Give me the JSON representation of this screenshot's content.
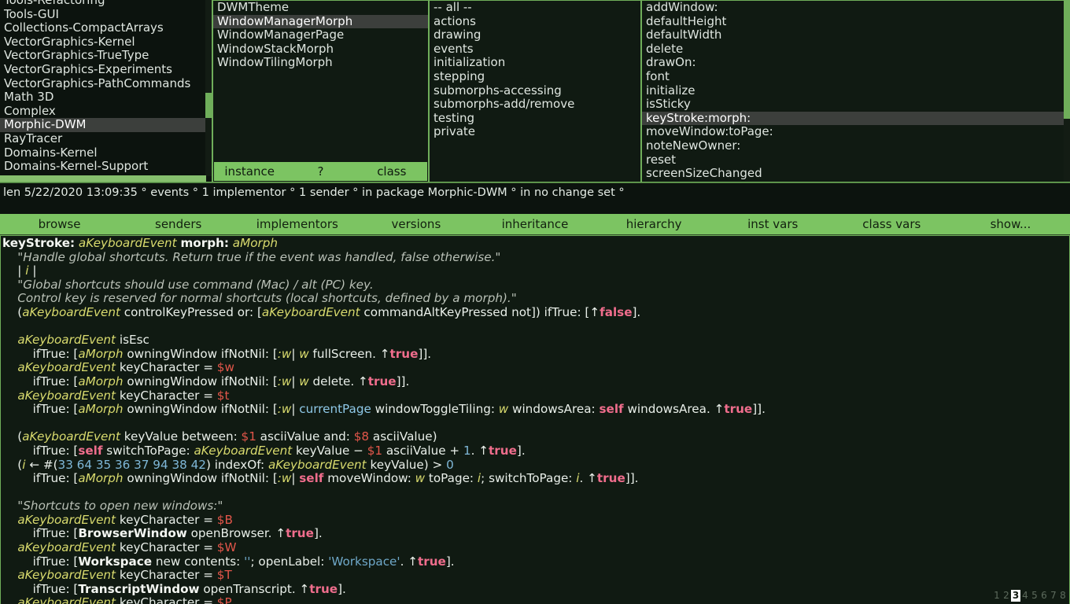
{
  "packages_pane": {
    "name": "package-list",
    "items": [
      {
        "label": "Tools-Refactoring",
        "selected": false
      },
      {
        "label": "Tools-GUI",
        "selected": false
      },
      {
        "label": "Collections-CompactArrays",
        "selected": false
      },
      {
        "label": "VectorGraphics-Kernel",
        "selected": false
      },
      {
        "label": "VectorGraphics-TrueType",
        "selected": false
      },
      {
        "label": "VectorGraphics-Experiments",
        "selected": false
      },
      {
        "label": "VectorGraphics-PathCommands",
        "selected": false
      },
      {
        "label": "Math 3D",
        "selected": false
      },
      {
        "label": "Complex",
        "selected": false
      },
      {
        "label": "Morphic-DWM",
        "selected": true
      },
      {
        "label": "RayTracer",
        "selected": false
      },
      {
        "label": "Domains-Kernel",
        "selected": false
      },
      {
        "label": "Domains-Kernel-Support",
        "selected": false
      }
    ]
  },
  "classes_pane": {
    "name": "class-list",
    "items": [
      {
        "label": "DWMTheme",
        "selected": false
      },
      {
        "label": "WindowManagerMorph",
        "selected": true
      },
      {
        "label": "WindowManagerPage",
        "selected": false
      },
      {
        "label": "WindowStackMorph",
        "selected": false
      },
      {
        "label": "WindowTilingMorph",
        "selected": false
      }
    ],
    "mode_buttons": [
      {
        "label": "instance"
      },
      {
        "label": "?"
      },
      {
        "label": "class"
      }
    ]
  },
  "categories_pane": {
    "name": "message-category-list",
    "items": [
      {
        "label": "-- all --",
        "selected": false
      },
      {
        "label": "actions",
        "selected": false
      },
      {
        "label": "drawing",
        "selected": false
      },
      {
        "label": "events",
        "selected": false
      },
      {
        "label": "initialization",
        "selected": false
      },
      {
        "label": "stepping",
        "selected": false
      },
      {
        "label": "submorphs-accessing",
        "selected": false
      },
      {
        "label": "submorphs-add/remove",
        "selected": false
      },
      {
        "label": "testing",
        "selected": false
      },
      {
        "label": "private",
        "selected": false
      }
    ]
  },
  "methods_pane": {
    "name": "method-list",
    "items": [
      {
        "label": "addWindow:",
        "selected": false
      },
      {
        "label": "defaultHeight",
        "selected": false
      },
      {
        "label": "defaultWidth",
        "selected": false
      },
      {
        "label": "delete",
        "selected": false
      },
      {
        "label": "drawOn:",
        "selected": false
      },
      {
        "label": "font",
        "selected": false
      },
      {
        "label": "initialize",
        "selected": false
      },
      {
        "label": "isSticky",
        "selected": false
      },
      {
        "label": "keyStroke:morph:",
        "selected": true
      },
      {
        "label": "moveWindow:toPage:",
        "selected": false
      },
      {
        "label": "noteNewOwner:",
        "selected": false
      },
      {
        "label": "reset",
        "selected": false
      },
      {
        "label": "screenSizeChanged",
        "selected": false
      }
    ]
  },
  "status": {
    "text": "len 5/22/2020 13:09:35 ° events ° 1 implementor ° 1 sender ° in package Morphic-DWM ° in no change set °"
  },
  "button_bar": {
    "buttons": [
      {
        "label": "browse"
      },
      {
        "label": "senders"
      },
      {
        "label": "implementors"
      },
      {
        "label": "versions"
      },
      {
        "label": "inheritance"
      },
      {
        "label": "hierarchy"
      },
      {
        "label": "inst vars"
      },
      {
        "label": "class vars"
      },
      {
        "label": "show..."
      }
    ]
  },
  "code": {
    "lines": [
      [
        {
          "t": "keyStroke:",
          "c": "kw"
        },
        {
          "t": " ",
          "c": ""
        },
        {
          "t": "aKeyboardEvent",
          "c": "arg"
        },
        {
          "t": " ",
          "c": ""
        },
        {
          "t": "morph:",
          "c": "kw"
        },
        {
          "t": " ",
          "c": ""
        },
        {
          "t": "aMorph",
          "c": "arg"
        }
      ],
      [
        {
          "t": "    \"Handle global shortcuts. Return true if the event was handled, false otherwise.\"",
          "c": "cmt"
        }
      ],
      [
        {
          "t": "    | ",
          "c": ""
        },
        {
          "t": "i",
          "c": "tmp"
        },
        {
          "t": " |",
          "c": ""
        }
      ],
      [
        {
          "t": "    \"Global shortcuts should use command (Mac) / alt (PC) key.",
          "c": "cmt"
        }
      ],
      [
        {
          "t": "    Control key is reserved for normal shortcuts (local shortcuts, defined by a morph).\"",
          "c": "cmt"
        }
      ],
      [
        {
          "t": "    (",
          "c": ""
        },
        {
          "t": "aKeyboardEvent",
          "c": "arg"
        },
        {
          "t": " controlKeyPressed or: [",
          "c": ""
        },
        {
          "t": "aKeyboardEvent",
          "c": "arg"
        },
        {
          "t": " commandAltKeyPressed not]) ifTrue: [",
          "c": ""
        },
        {
          "t": "↑",
          "c": ""
        },
        {
          "t": "false",
          "c": "pseudo"
        },
        {
          "t": "].",
          "c": ""
        }
      ],
      [
        {
          "t": "",
          "c": ""
        }
      ],
      [
        {
          "t": "    ",
          "c": ""
        },
        {
          "t": "aKeyboardEvent",
          "c": "arg"
        },
        {
          "t": " isEsc",
          "c": ""
        }
      ],
      [
        {
          "t": "        ifTrue: [",
          "c": ""
        },
        {
          "t": "aMorph",
          "c": "arg"
        },
        {
          "t": " owningWindow ifNotNil: [",
          "c": ""
        },
        {
          "t": ":w",
          "c": "blkarg"
        },
        {
          "t": "| ",
          "c": ""
        },
        {
          "t": "w",
          "c": "blkarg"
        },
        {
          "t": " fullScreen. ↑",
          "c": ""
        },
        {
          "t": "true",
          "c": "pseudo"
        },
        {
          "t": "]].",
          "c": ""
        }
      ],
      [
        {
          "t": "    ",
          "c": ""
        },
        {
          "t": "aKeyboardEvent",
          "c": "arg"
        },
        {
          "t": " keyCharacter = ",
          "c": ""
        },
        {
          "t": "$w",
          "c": "lit"
        }
      ],
      [
        {
          "t": "        ifTrue: [",
          "c": ""
        },
        {
          "t": "aMorph",
          "c": "arg"
        },
        {
          "t": " owningWindow ifNotNil: [",
          "c": ""
        },
        {
          "t": ":w",
          "c": "blkarg"
        },
        {
          "t": "| ",
          "c": ""
        },
        {
          "t": "w",
          "c": "blkarg"
        },
        {
          "t": " delete. ↑",
          "c": ""
        },
        {
          "t": "true",
          "c": "pseudo"
        },
        {
          "t": "]].",
          "c": ""
        }
      ],
      [
        {
          "t": "    ",
          "c": ""
        },
        {
          "t": "aKeyboardEvent",
          "c": "arg"
        },
        {
          "t": " keyCharacter = ",
          "c": ""
        },
        {
          "t": "$t",
          "c": "lit"
        }
      ],
      [
        {
          "t": "        ifTrue: [",
          "c": ""
        },
        {
          "t": "aMorph",
          "c": "arg"
        },
        {
          "t": " owningWindow ifNotNil: [",
          "c": ""
        },
        {
          "t": ":w",
          "c": "blkarg"
        },
        {
          "t": "| ",
          "c": ""
        },
        {
          "t": "currentPage",
          "c": "pg"
        },
        {
          "t": " windowToggleTiling: ",
          "c": ""
        },
        {
          "t": "w",
          "c": "blkarg"
        },
        {
          "t": " windowsArea: ",
          "c": ""
        },
        {
          "t": "self",
          "c": "pseudo"
        },
        {
          "t": " windowsArea. ↑",
          "c": ""
        },
        {
          "t": "true",
          "c": "pseudo"
        },
        {
          "t": "]].",
          "c": ""
        }
      ],
      [
        {
          "t": "",
          "c": ""
        }
      ],
      [
        {
          "t": "    (",
          "c": ""
        },
        {
          "t": "aKeyboardEvent",
          "c": "arg"
        },
        {
          "t": " keyValue between: ",
          "c": ""
        },
        {
          "t": "$1",
          "c": "lit"
        },
        {
          "t": " asciiValue and: ",
          "c": ""
        },
        {
          "t": "$8",
          "c": "lit"
        },
        {
          "t": " asciiValue)",
          "c": ""
        }
      ],
      [
        {
          "t": "        ifTrue: [",
          "c": ""
        },
        {
          "t": "self",
          "c": "pseudo"
        },
        {
          "t": " switchToPage: ",
          "c": ""
        },
        {
          "t": "aKeyboardEvent",
          "c": "arg"
        },
        {
          "t": " keyValue − ",
          "c": ""
        },
        {
          "t": "$1",
          "c": "lit"
        },
        {
          "t": " asciiValue + ",
          "c": ""
        },
        {
          "t": "1",
          "c": "num"
        },
        {
          "t": ". ↑",
          "c": ""
        },
        {
          "t": "true",
          "c": "pseudo"
        },
        {
          "t": "].",
          "c": ""
        }
      ],
      [
        {
          "t": "    (",
          "c": ""
        },
        {
          "t": "i",
          "c": "tmp"
        },
        {
          "t": " ← #(",
          "c": ""
        },
        {
          "t": "33 64 35 36 37 94 38 42",
          "c": "num"
        },
        {
          "t": ") indexOf: ",
          "c": ""
        },
        {
          "t": "aKeyboardEvent",
          "c": "arg"
        },
        {
          "t": " keyValue) > ",
          "c": ""
        },
        {
          "t": "0",
          "c": "num"
        }
      ],
      [
        {
          "t": "        ifTrue: [",
          "c": ""
        },
        {
          "t": "aMorph",
          "c": "arg"
        },
        {
          "t": " owningWindow ifNotNil: [",
          "c": ""
        },
        {
          "t": ":w",
          "c": "blkarg"
        },
        {
          "t": "| ",
          "c": ""
        },
        {
          "t": "self",
          "c": "pseudo"
        },
        {
          "t": " moveWindow: ",
          "c": ""
        },
        {
          "t": "w",
          "c": "blkarg"
        },
        {
          "t": " toPage: ",
          "c": ""
        },
        {
          "t": "i",
          "c": "tmp"
        },
        {
          "t": "; switchToPage: ",
          "c": ""
        },
        {
          "t": "i",
          "c": "tmp"
        },
        {
          "t": ". ↑",
          "c": ""
        },
        {
          "t": "true",
          "c": "pseudo"
        },
        {
          "t": "]].",
          "c": ""
        }
      ],
      [
        {
          "t": "",
          "c": ""
        }
      ],
      [
        {
          "t": "    \"Shortcuts to open new windows:\"",
          "c": "cmt"
        }
      ],
      [
        {
          "t": "    ",
          "c": ""
        },
        {
          "t": "aKeyboardEvent",
          "c": "arg"
        },
        {
          "t": " keyCharacter = ",
          "c": ""
        },
        {
          "t": "$B",
          "c": "lit"
        }
      ],
      [
        {
          "t": "        ifTrue: [",
          "c": ""
        },
        {
          "t": "BrowserWindow",
          "c": "gvar"
        },
        {
          "t": " openBrowser. ↑",
          "c": ""
        },
        {
          "t": "true",
          "c": "pseudo"
        },
        {
          "t": "].",
          "c": ""
        }
      ],
      [
        {
          "t": "    ",
          "c": ""
        },
        {
          "t": "aKeyboardEvent",
          "c": "arg"
        },
        {
          "t": " keyCharacter = ",
          "c": ""
        },
        {
          "t": "$W",
          "c": "lit"
        }
      ],
      [
        {
          "t": "        ifTrue: [",
          "c": ""
        },
        {
          "t": "Workspace",
          "c": "gvar"
        },
        {
          "t": " new contents: ",
          "c": ""
        },
        {
          "t": "''",
          "c": "str"
        },
        {
          "t": "; openLabel: ",
          "c": ""
        },
        {
          "t": "'Workspace'",
          "c": "str"
        },
        {
          "t": ". ↑",
          "c": ""
        },
        {
          "t": "true",
          "c": "pseudo"
        },
        {
          "t": "].",
          "c": ""
        }
      ],
      [
        {
          "t": "    ",
          "c": ""
        },
        {
          "t": "aKeyboardEvent",
          "c": "arg"
        },
        {
          "t": " keyCharacter = ",
          "c": ""
        },
        {
          "t": "$T",
          "c": "lit"
        }
      ],
      [
        {
          "t": "        ifTrue: [",
          "c": ""
        },
        {
          "t": "TranscriptWindow",
          "c": "gvar"
        },
        {
          "t": " openTranscript. ↑",
          "c": ""
        },
        {
          "t": "true",
          "c": "pseudo"
        },
        {
          "t": "].",
          "c": ""
        }
      ],
      [
        {
          "t": "    ",
          "c": ""
        },
        {
          "t": "aKeyboardEvent",
          "c": "arg"
        },
        {
          "t": " keyCharacter = ",
          "c": ""
        },
        {
          "t": "$P",
          "c": "lit"
        }
      ]
    ]
  },
  "page_indicator": {
    "pages": [
      "1",
      "2",
      "3",
      "4",
      "5",
      "6",
      "7",
      "8"
    ],
    "active": "3"
  },
  "colors": {
    "accent_green": "#7cc462",
    "pane_bg": "#101a12",
    "selection": "#3c3f3c",
    "text": "#e4ece5"
  }
}
